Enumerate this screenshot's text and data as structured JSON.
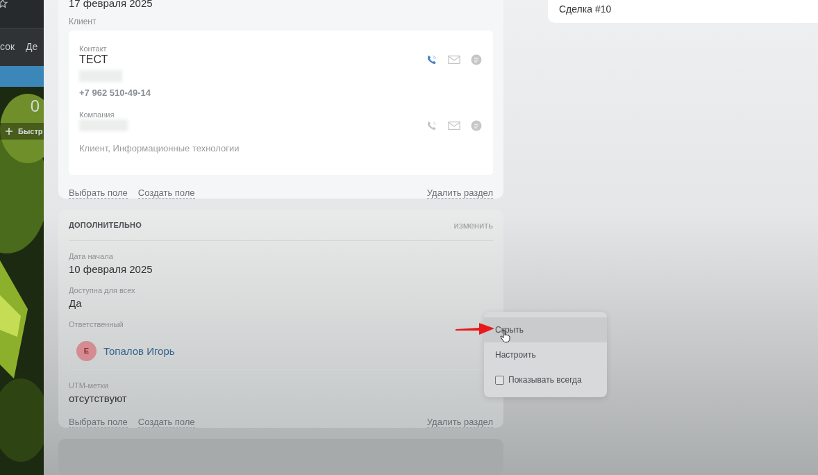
{
  "sidebar": {
    "tabs": [
      "сок",
      "Де"
    ],
    "counter": "0",
    "quick_button": "Быстр"
  },
  "client_card": {
    "top_value": "17 февраля 2025",
    "label": "Клиент",
    "entries": [
      {
        "kind": "contact",
        "label": "Контакт",
        "name": "ТЕСТ",
        "detail": "+7 962 510-49-14",
        "call_active": true
      },
      {
        "kind": "company",
        "label": "Компания",
        "detail": "Клиент, Информационные технологии",
        "call_active": false
      }
    ],
    "links": [
      "Выбрать поле",
      "Создать поле"
    ],
    "delete_link": "Удалить раздел"
  },
  "extra_card": {
    "title": "ДОПОЛНИТЕЛЬНО",
    "edit_link": "изменить",
    "fields": [
      {
        "kind": "text",
        "label": "Дата начала",
        "value": "10 февраля 2025"
      },
      {
        "kind": "text",
        "label": "Доступна для всех",
        "value": "Да"
      },
      {
        "kind": "user",
        "label": "Ответственный",
        "initial": "Е",
        "value": "Топалов Игорь"
      },
      {
        "kind": "text",
        "label": "UTM-метки",
        "value": "отсутствуют"
      }
    ],
    "links": [
      "Выбрать поле",
      "Создать поле"
    ],
    "delete_link": "Удалить раздел"
  },
  "right_card": {
    "title": "Сделка #10"
  },
  "context_menu": {
    "items": [
      {
        "kind": "action",
        "label": "Скрыть",
        "selected": true
      },
      {
        "kind": "action",
        "label": "Настроить",
        "selected": false
      },
      {
        "kind": "checkbox",
        "label": "Показывать всегда",
        "checked": false
      }
    ]
  }
}
